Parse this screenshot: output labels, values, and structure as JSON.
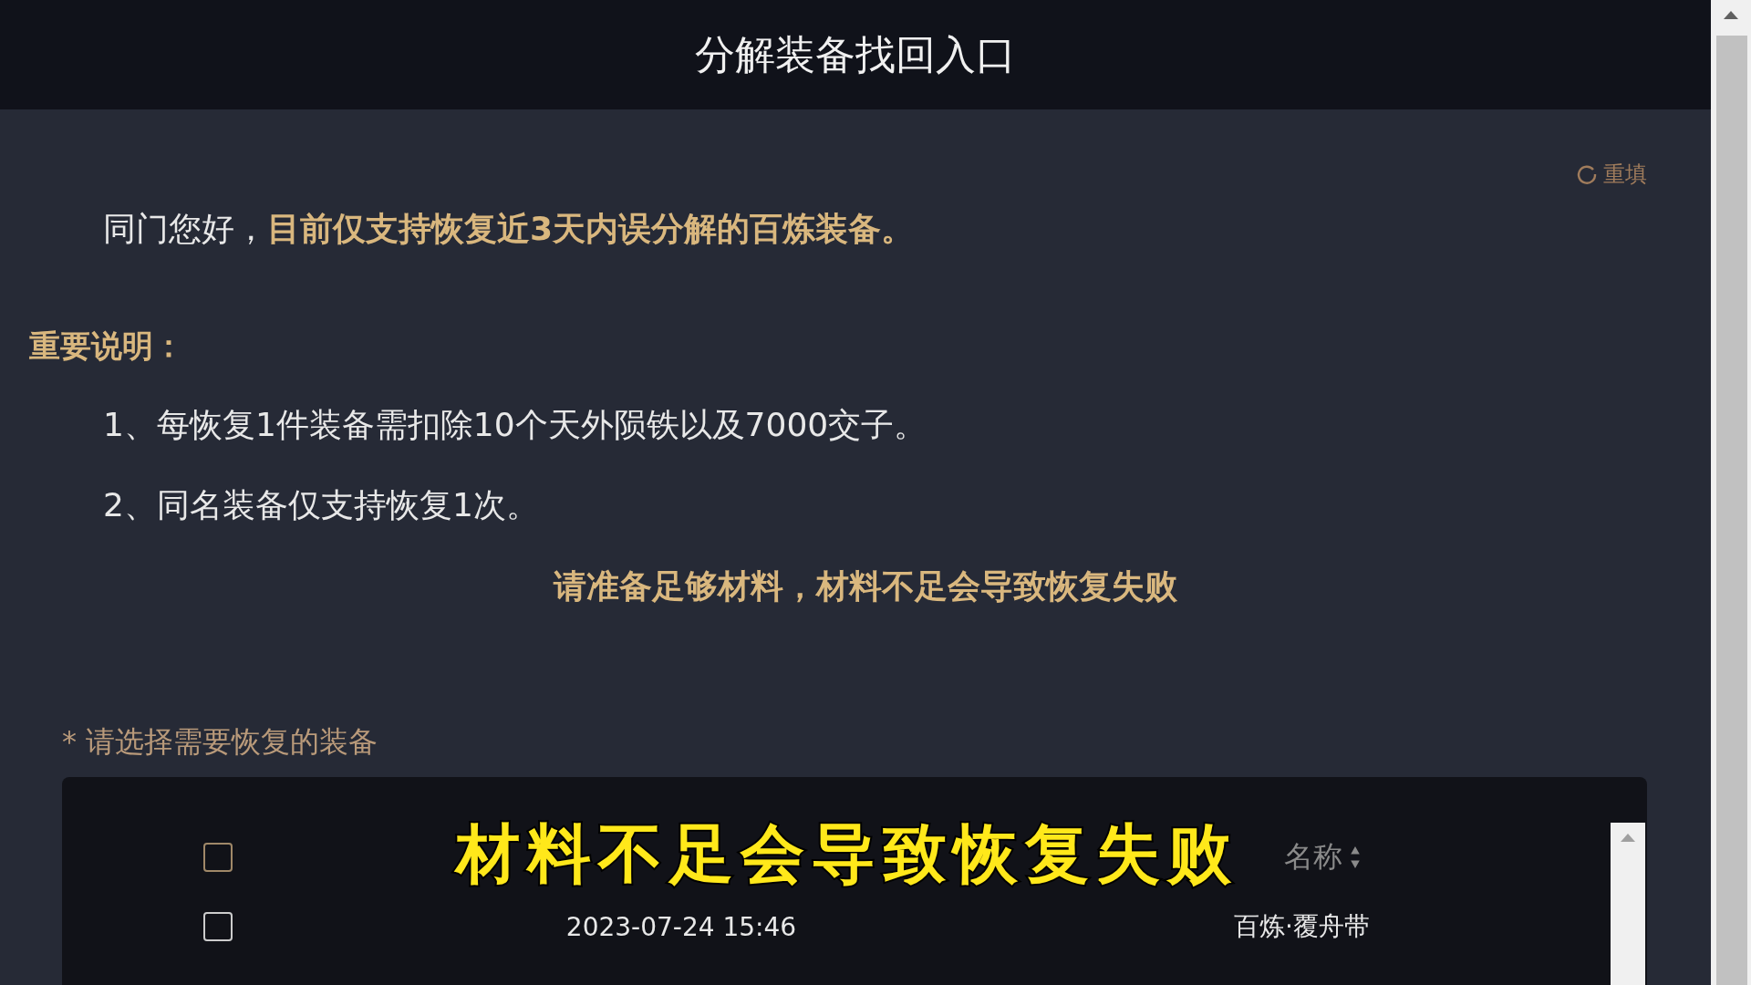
{
  "header": {
    "title": "分解装备找回入口"
  },
  "reset_button": {
    "label": "重填"
  },
  "intro": "同门您好，**目前仅支持恢复近3天内误分解的百炼装备。**",
  "notice": {
    "heading": "重要说明：",
    "items": [
      "1、每恢复1件装备需扣除10个天外陨铁以及7000交子。",
      "2、同名装备仅支持恢复1次。"
    ]
  },
  "warning": "请准备足够材料，材料不足会导致恢复失败",
  "form": {
    "required_mark": "*",
    "label": "请选择需要恢复的装备"
  },
  "table": {
    "header": {
      "checked": false,
      "column_3": "名称"
    },
    "rows": [
      {
        "checked": false,
        "time": "2023-07-24 15:46",
        "name": "百炼·覆舟带"
      }
    ]
  },
  "subtitle": "材料不足会导致恢复失败"
}
